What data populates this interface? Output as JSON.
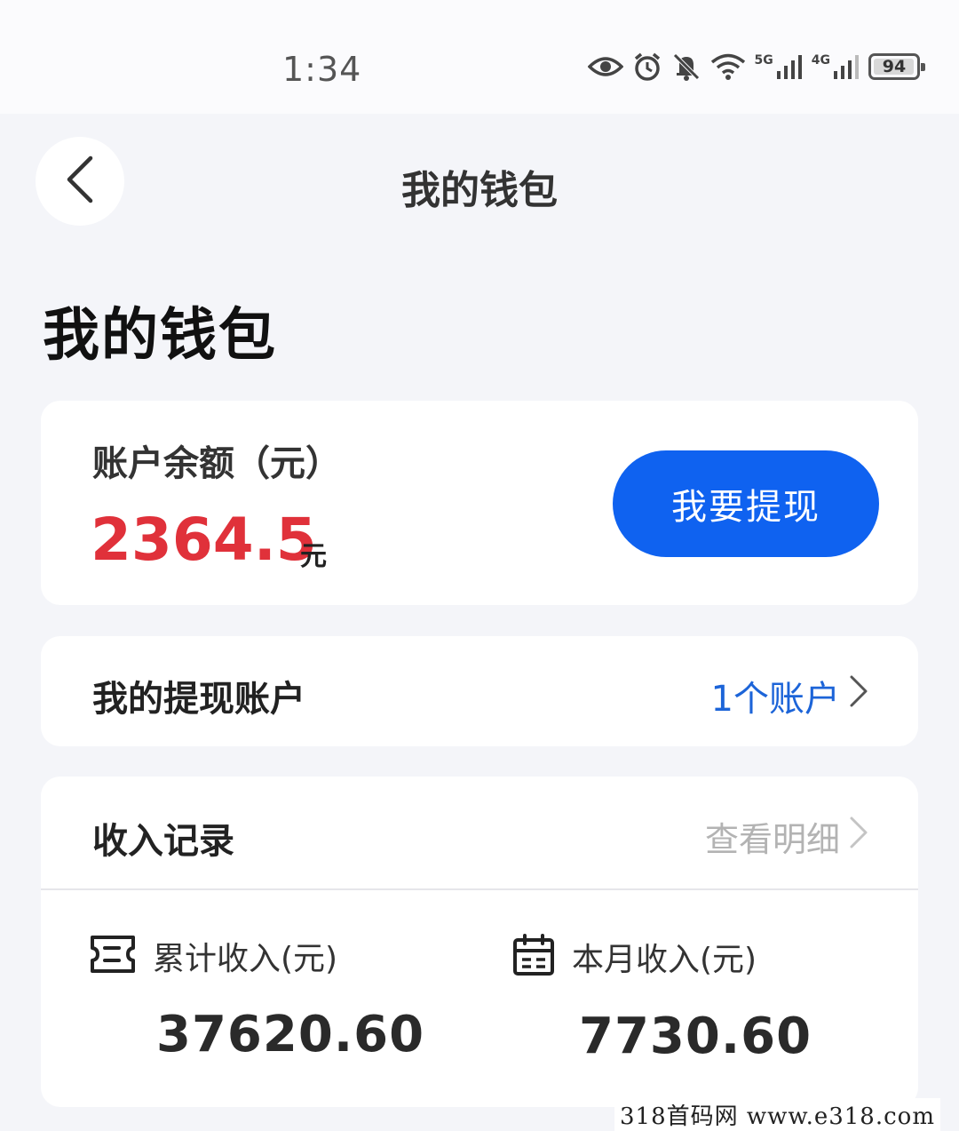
{
  "status_bar": {
    "time": "1:34",
    "network_5g": "5G",
    "network_4g": "4G",
    "battery": "94"
  },
  "nav": {
    "title": "我的钱包"
  },
  "page_title": "我的钱包",
  "balance": {
    "label": "账户余额（元）",
    "amount": "2364.5",
    "unit": "元",
    "withdraw_label": "我要提现"
  },
  "withdraw_account": {
    "label": "我的提现账户",
    "value": "1个账户"
  },
  "income": {
    "label": "收入记录",
    "detail_link": "查看明细",
    "total_label": "累计收入(元)",
    "total_value": "37620.60",
    "month_label": "本月收入(元)",
    "month_value": "7730.60"
  },
  "watermark": "318首码网   www.e318.com",
  "colors": {
    "accent_blue": "#0f62f0",
    "link_blue": "#1c64d8",
    "amount_red": "#e0313a"
  }
}
